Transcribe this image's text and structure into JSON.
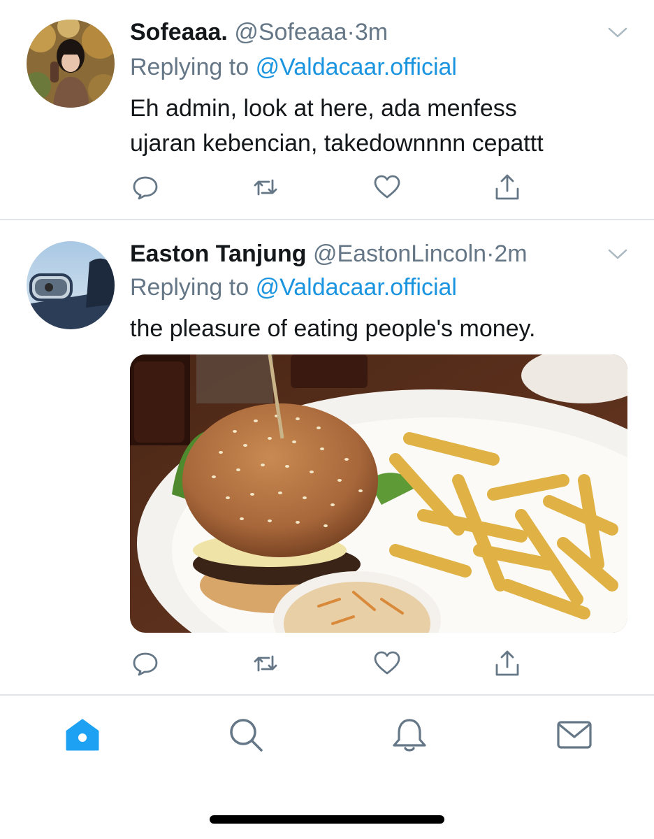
{
  "tweets": [
    {
      "display_name": "Sofeaaa.",
      "handle": "@Sofeaaa",
      "separator": "·",
      "time": "3m",
      "replying_prefix": "Replying to",
      "replying_handle": "@Valdacaar.official",
      "text_lines": [
        "Eh admin, look at here, ada menfess",
        "ujaran kebencian, takedownnnn cepattt"
      ]
    },
    {
      "display_name": "Easton Tanjung",
      "handle": "@EastonLincoln",
      "separator": "·",
      "time": "2m",
      "replying_prefix": "Replying to",
      "replying_handle": "@Valdacaar.official",
      "text": "the pleasure of eating people's money.",
      "media": "burger-and-fries-photo"
    }
  ],
  "actions": [
    "reply-icon",
    "retweet-icon",
    "like-icon",
    "share-icon"
  ],
  "tabbar": {
    "tabs": [
      "home-icon",
      "search-icon",
      "notifications-icon",
      "messages-icon"
    ],
    "active": "home-icon"
  },
  "colors": {
    "accent": "#1da1f2",
    "link": "#1b95e0",
    "secondary_text": "#657786",
    "icon": "#657786",
    "divider": "#e3e6e8"
  }
}
